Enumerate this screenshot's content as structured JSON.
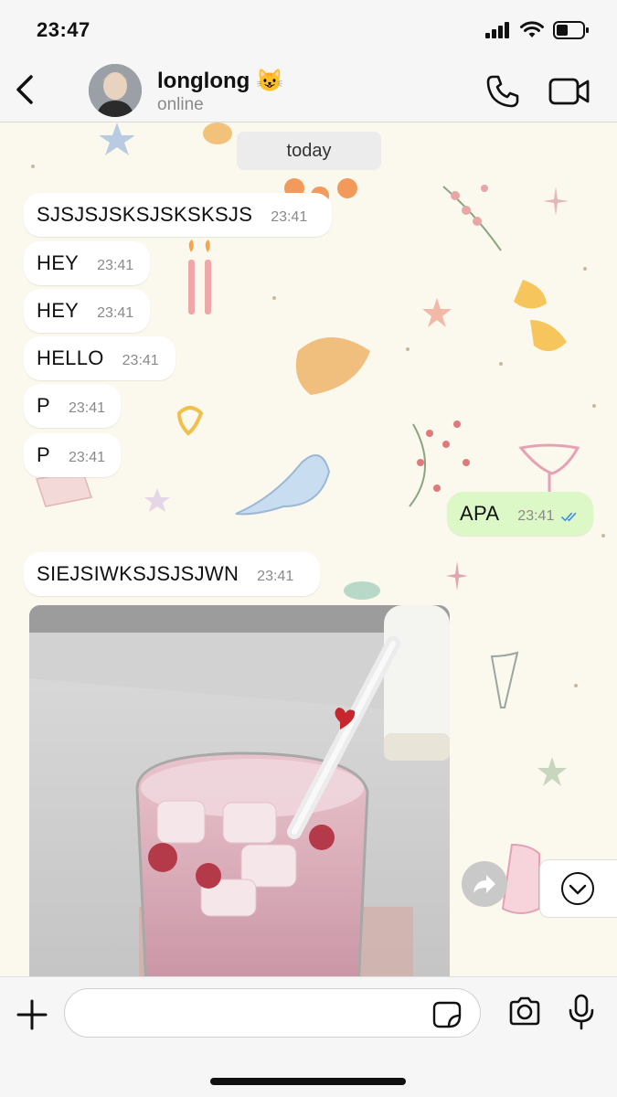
{
  "status_bar": {
    "time": "23:47",
    "icons": [
      "signal-icon",
      "wifi-icon",
      "battery-icon"
    ]
  },
  "header": {
    "contact_name": "longlong 😺",
    "contact_status": "online",
    "icons": [
      "back-icon",
      "phone-icon",
      "video-camera-icon"
    ]
  },
  "chat": {
    "date_label": "today",
    "messages": [
      {
        "direction": "incoming",
        "text": "SJSJSJSKSJSKSKSJS",
        "time": "23:41"
      },
      {
        "direction": "incoming",
        "text": "HEY",
        "time": "23:41"
      },
      {
        "direction": "incoming",
        "text": "HEY",
        "time": "23:41"
      },
      {
        "direction": "incoming",
        "text": "HELLO",
        "time": "23:41"
      },
      {
        "direction": "incoming",
        "text": "P",
        "time": "23:41"
      },
      {
        "direction": "incoming",
        "text": "P",
        "time": "23:41"
      },
      {
        "direction": "outgoing",
        "text": "APA",
        "time": "23:41",
        "status": "read"
      },
      {
        "direction": "incoming",
        "text": "SIEJSIWKSJSJSJWN",
        "time": "23:41"
      }
    ],
    "photo_icon": "photo-message",
    "colors": {
      "incoming_bubble": "#ffffff",
      "outgoing_bubble": "#dcf8c6",
      "read_ticks": "#3d8bf0",
      "wallpaper": "#fbf8ee"
    }
  },
  "input": {
    "placeholder": "",
    "icons": [
      "plus-icon",
      "sticker-icon",
      "camera-icon",
      "microphone-icon"
    ]
  }
}
